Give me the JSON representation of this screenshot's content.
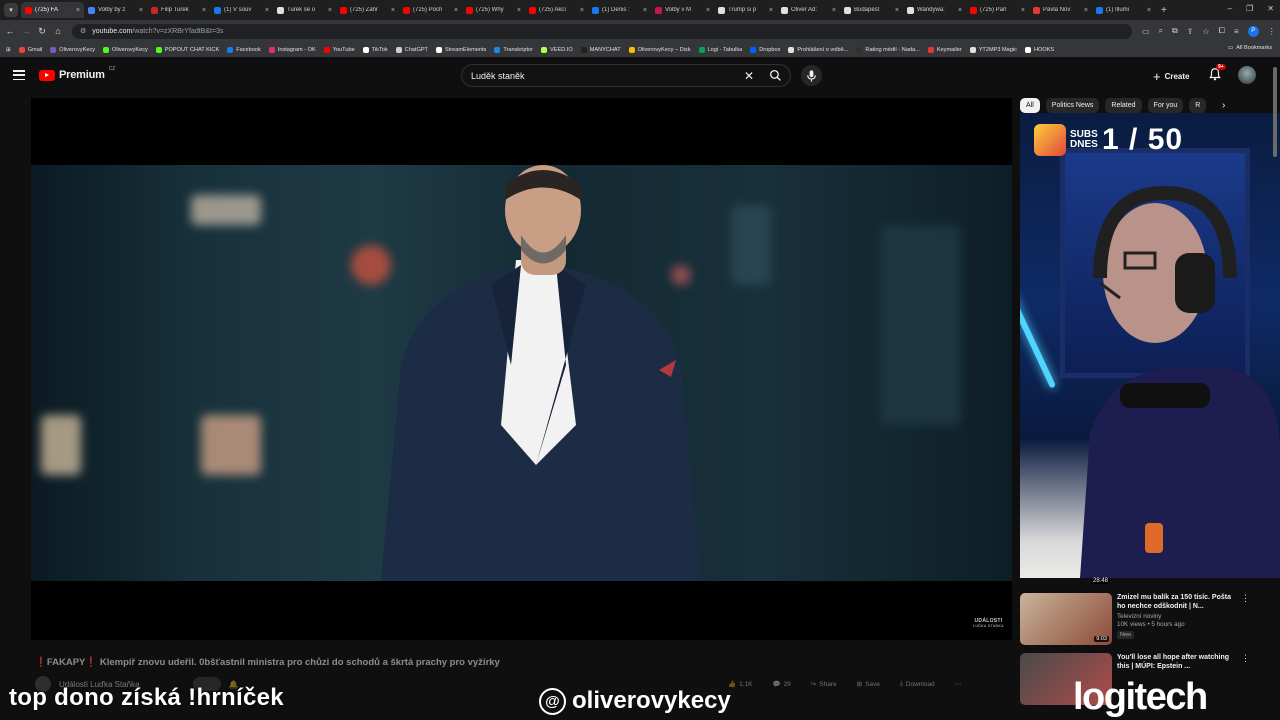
{
  "browser": {
    "tabs": [
      {
        "title": "(725) FA",
        "color": "#ff0000",
        "active": true
      },
      {
        "title": "Volby by z",
        "color": "#4285f4"
      },
      {
        "title": "Filip Turek",
        "color": "#c62828"
      },
      {
        "title": "(1) V souv",
        "color": "#1877f2"
      },
      {
        "title": "Turek se o",
        "color": "#e0e0e0"
      },
      {
        "title": "(725) Zahr",
        "color": "#ff0000"
      },
      {
        "title": "(725) Poch",
        "color": "#ff0000"
      },
      {
        "title": "(725) Why",
        "color": "#ff0000"
      },
      {
        "title": "(725) Akcí",
        "color": "#ff0000"
      },
      {
        "title": "(1) Denis :",
        "color": "#1877f2"
      },
      {
        "title": "Volby v M",
        "color": "#c2185b"
      },
      {
        "title": "Trump si p",
        "color": "#e0e0e0"
      },
      {
        "title": "Oliver Ad:",
        "color": "#e0e0e0"
      },
      {
        "title": "Budapest",
        "color": "#e0e0e0"
      },
      {
        "title": "Wandywa:",
        "color": "#e0e0e0"
      },
      {
        "title": "(725) Parl",
        "color": "#ff0000"
      },
      {
        "title": "Pavla Nov",
        "color": "#e53935"
      },
      {
        "title": "(1) Illumi",
        "color": "#1877f2"
      }
    ],
    "url_host": "youtube.com",
    "url_path": "/watch?v=zXRBrYfadtB&t=3s",
    "profile_letter": "P",
    "bookmarks": [
      {
        "label": "Gmail",
        "color": "#ea4335"
      },
      {
        "label": "OliverovyKecy",
        "color": "#7e57c2"
      },
      {
        "label": "OliverovyKecy",
        "color": "#53fc18"
      },
      {
        "label": "POPOUT CHAT KICK",
        "color": "#53fc18"
      },
      {
        "label": "Facebook",
        "color": "#1877f2"
      },
      {
        "label": "Instagram - OK",
        "color": "#e1306c"
      },
      {
        "label": "YouTube",
        "color": "#ff0000"
      },
      {
        "label": "TikTok",
        "color": "#ffffff"
      },
      {
        "label": "ChatGPT",
        "color": "#cfcfcf"
      },
      {
        "label": "StreamElements",
        "color": "#ffffff"
      },
      {
        "label": "Transkriptor",
        "color": "#1e88e5"
      },
      {
        "label": "VEED.IO",
        "color": "#b2ff59"
      },
      {
        "label": "MANYCHAT",
        "color": "#222222"
      },
      {
        "label": "OliverovyKecy – Disk",
        "color": "#fbbc04"
      },
      {
        "label": "Logi - Tabulka",
        "color": "#0f9d58"
      },
      {
        "label": "Dropbox",
        "color": "#0061ff"
      },
      {
        "label": "Prohlášení o volbě...",
        "color": "#e0e0e0"
      },
      {
        "label": "Rating médií - Nada...",
        "color": "#303030"
      },
      {
        "label": "Keymailer",
        "color": "#e53935"
      },
      {
        "label": "YT2MP3 Magic",
        "color": "#e0e0e0"
      },
      {
        "label": "HOOKS",
        "color": "#ffffff"
      }
    ],
    "all_bookmarks": "All Bookmarks"
  },
  "youtube": {
    "logo_word": "Premium",
    "logo_country": "CZ",
    "search_query": "Luděk staněk",
    "create_label": "Create",
    "notif_badge": "9+",
    "chips": [
      {
        "label": "All",
        "selected": true
      },
      {
        "label": "Politics News"
      },
      {
        "label": "Related"
      },
      {
        "label": "For you"
      },
      {
        "label": "R"
      }
    ]
  },
  "video": {
    "title_emoji_left": "❗",
    "title_emph": "FAKAPY",
    "title_emoji_right": "❗",
    "title_rest": " Klempíř znovu udeřil. 0bšťastnil ministra pro chůzi do schodů a škrtá prachy pro vyžírky",
    "channel_name": "Události Luďka Staňka",
    "watermark_line1": "UDÁLOSTI",
    "watermark_line2": "LUĎKA STAŇKA",
    "likes": "1.1K",
    "comments": "29",
    "share": "Share",
    "save": "Save",
    "download": "Download"
  },
  "webcam": {
    "subs_label_1": "SUBS",
    "subs_label_2": "DNES",
    "subs_count": "1 / 50"
  },
  "recommended": [
    {
      "title": "Zmizel mu balík za 150 tisíc. Pošta ho nechce odškodnit | N...",
      "channel": "Televizní noviny",
      "meta": "10K views • 5 hours ago",
      "badge": "New",
      "duration": "9:03",
      "thumb_colors": [
        "#c9b59a",
        "#8c4a3a"
      ]
    },
    {
      "title": "You'll lose all hope after watching this | MÚPI: Epstein ...",
      "channel": "",
      "meta": "",
      "badge": "",
      "duration": "",
      "thumb_colors": [
        "#4a4a4a",
        "#b04a4a"
      ]
    }
  ],
  "prev_rec_duration": "28:48",
  "overlay": {
    "left_text": "top dono získá !hrníček",
    "handle": "oliverovykecy",
    "brand": "logitech"
  }
}
